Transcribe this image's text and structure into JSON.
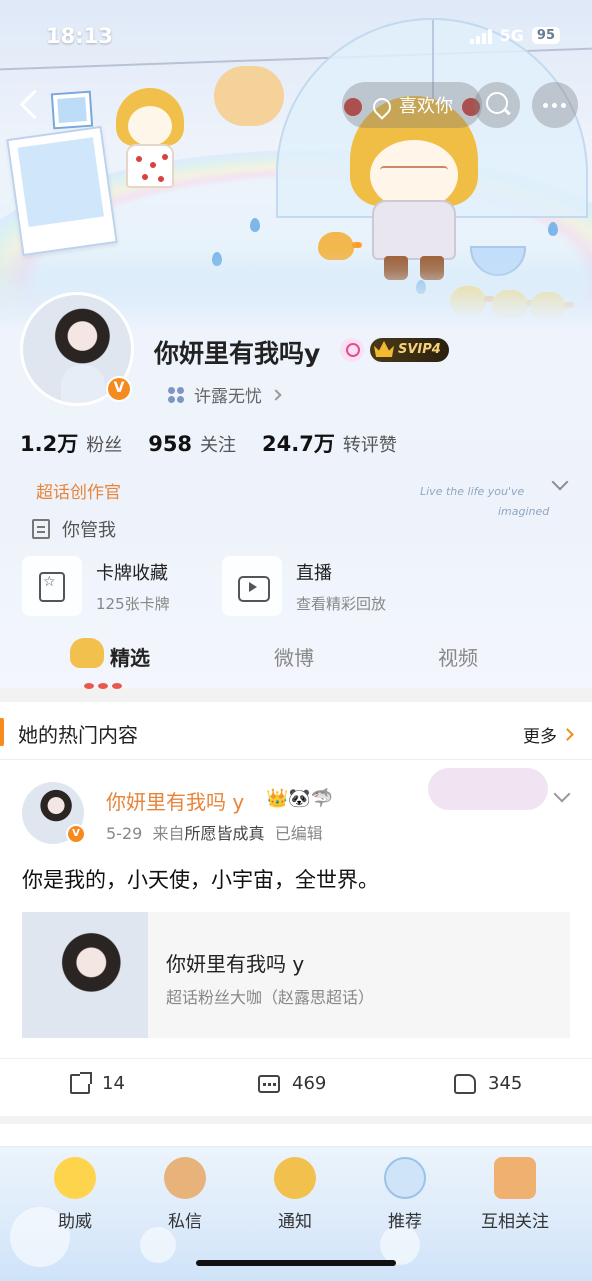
{
  "status_bar": {
    "time": "18:13",
    "network": "5G",
    "battery": "95"
  },
  "top_nav": {
    "like_label": "喜欢你"
  },
  "profile": {
    "username": "你妍里有我吗y",
    "vip_label": "SVIP4",
    "supertopic": "许露无忧",
    "stats": [
      {
        "value": "1.2万",
        "label": "粉丝"
      },
      {
        "value": "958",
        "label": "关注"
      },
      {
        "value": "24.7万",
        "label": "转评赞"
      }
    ],
    "creator_badge": "超话创作官",
    "deco_text_line1": "Live the life you've",
    "deco_text_line2": "imagined",
    "bio": "你管我",
    "shortcuts": [
      {
        "title": "卡牌收藏",
        "sub": "125张卡牌",
        "icon": "card-collection-icon"
      },
      {
        "title": "直播",
        "sub": "查看精彩回放",
        "icon": "live-tv-icon"
      }
    ],
    "tabs": [
      "精选",
      "微博",
      "视频"
    ]
  },
  "hot_section": {
    "title": "她的热门内容",
    "more": "更多",
    "post": {
      "author": "你妍里有我吗 y",
      "emojis": "👑🐼🦈",
      "date": "5-29",
      "source_prefix": "来自",
      "source": "所愿皆成真",
      "edited": "已编辑",
      "text": "你是我的，小天使，小宇宙，全世界。",
      "card_title": "你妍里有我吗 y",
      "card_sub": "超话粉丝大咖（赵露思超话）",
      "reposts": "14",
      "comments": "469",
      "likes": "345"
    }
  },
  "bottom_bar": [
    "助威",
    "私信",
    "通知",
    "推荐",
    "互相关注"
  ],
  "colors": {
    "accent": "#f58b1f",
    "name_orange": "#e8843a"
  }
}
